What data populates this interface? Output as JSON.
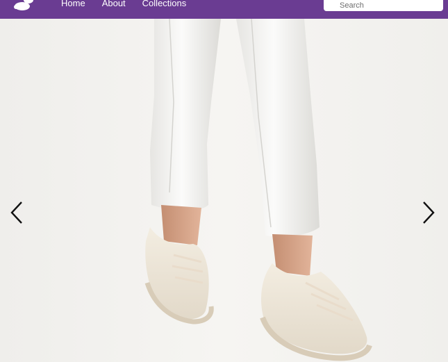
{
  "nav": {
    "logo": "logo-icon",
    "links": [
      "Home",
      "About",
      "Collections"
    ]
  },
  "search": {
    "placeholder": "Search"
  },
  "carousel": {
    "prev_icon": "chevron-left-icon",
    "next_icon": "chevron-right-icon",
    "slide_image": "woman-in-white-pants-and-cream-sneakers"
  },
  "colors": {
    "navbar": "#6a3c92",
    "nav_text": "#ffffff",
    "background": "#f2f1ee",
    "arrow": "#111111"
  }
}
